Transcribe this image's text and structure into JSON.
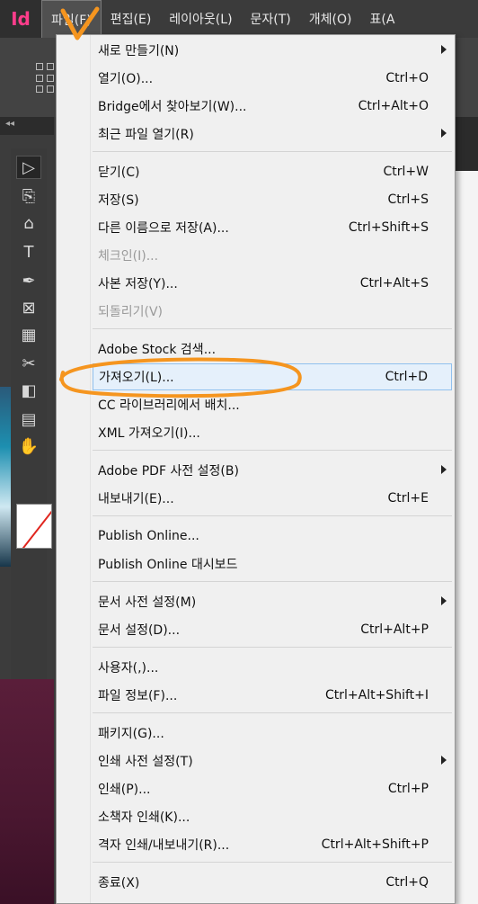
{
  "app": {
    "logo": "Id"
  },
  "menubar": {
    "items": [
      "파일(F)",
      "편집(E)",
      "레이아웃(L)",
      "문자(T)",
      "개체(O)",
      "표(A"
    ]
  },
  "panel_strip": {
    "label": "◂◂"
  },
  "file_menu": {
    "items": [
      {
        "label": "새로 만들기(N)",
        "shortcut": "",
        "submenu": true,
        "disabled": false
      },
      {
        "label": "열기(O)...",
        "shortcut": "Ctrl+O",
        "submenu": false,
        "disabled": false
      },
      {
        "label": "Bridge에서 찾아보기(W)...",
        "shortcut": "Ctrl+Alt+O",
        "submenu": false,
        "disabled": false
      },
      {
        "label": "최근 파일 열기(R)",
        "shortcut": "",
        "submenu": true,
        "disabled": false
      },
      {
        "label": "닫기(C)",
        "shortcut": "Ctrl+W",
        "submenu": false,
        "disabled": false
      },
      {
        "label": "저장(S)",
        "shortcut": "Ctrl+S",
        "submenu": false,
        "disabled": false
      },
      {
        "label": "다른 이름으로 저장(A)...",
        "shortcut": "Ctrl+Shift+S",
        "submenu": false,
        "disabled": false
      },
      {
        "label": "체크인(I)...",
        "shortcut": "",
        "submenu": false,
        "disabled": true
      },
      {
        "label": "사본 저장(Y)...",
        "shortcut": "Ctrl+Alt+S",
        "submenu": false,
        "disabled": false
      },
      {
        "label": "되돌리기(V)",
        "shortcut": "",
        "submenu": false,
        "disabled": true
      },
      {
        "label": "Adobe Stock 검색...",
        "shortcut": "",
        "submenu": false,
        "disabled": false
      },
      {
        "label": "가져오기(L)...",
        "shortcut": "Ctrl+D",
        "submenu": false,
        "disabled": false,
        "highlighted": true
      },
      {
        "label": "CC 라이브러리에서 배치...",
        "shortcut": "",
        "submenu": false,
        "disabled": false
      },
      {
        "label": "XML 가져오기(I)...",
        "shortcut": "",
        "submenu": false,
        "disabled": false
      },
      {
        "label": "Adobe PDF 사전 설정(B)",
        "shortcut": "",
        "submenu": true,
        "disabled": false
      },
      {
        "label": "내보내기(E)...",
        "shortcut": "Ctrl+E",
        "submenu": false,
        "disabled": false
      },
      {
        "label": "Publish Online...",
        "shortcut": "",
        "submenu": false,
        "disabled": false
      },
      {
        "label": "Publish Online 대시보드",
        "shortcut": "",
        "submenu": false,
        "disabled": false
      },
      {
        "label": "문서 사전 설정(M)",
        "shortcut": "",
        "submenu": true,
        "disabled": false
      },
      {
        "label": "문서 설정(D)...",
        "shortcut": "Ctrl+Alt+P",
        "submenu": false,
        "disabled": false
      },
      {
        "label": "사용자(,)...",
        "shortcut": "",
        "submenu": false,
        "disabled": false
      },
      {
        "label": "파일 정보(F)...",
        "shortcut": "Ctrl+Alt+Shift+I",
        "submenu": false,
        "disabled": false
      },
      {
        "label": "패키지(G)...",
        "shortcut": "",
        "submenu": false,
        "disabled": false
      },
      {
        "label": "인쇄 사전 설정(T)",
        "shortcut": "",
        "submenu": true,
        "disabled": false
      },
      {
        "label": "인쇄(P)...",
        "shortcut": "Ctrl+P",
        "submenu": false,
        "disabled": false
      },
      {
        "label": "소책자 인쇄(K)...",
        "shortcut": "",
        "submenu": false,
        "disabled": false
      },
      {
        "label": "격자 인쇄/내보내기(R)...",
        "shortcut": "Ctrl+Alt+Shift+P",
        "submenu": false,
        "disabled": false
      },
      {
        "label": "종료(X)",
        "shortcut": "Ctrl+Q",
        "submenu": false,
        "disabled": false
      }
    ]
  },
  "tools": [
    {
      "icon": "selection-tool-icon",
      "glyph": "▷",
      "selected": true
    },
    {
      "icon": "direct-selection-tool-icon",
      "glyph": "⎘",
      "selected": false
    },
    {
      "icon": "page-tool-icon",
      "glyph": "⌂",
      "selected": false
    },
    {
      "icon": "type-tool-icon",
      "glyph": "T",
      "selected": false
    },
    {
      "icon": "pen-tool-icon",
      "glyph": "✒",
      "selected": false
    },
    {
      "icon": "rectangle-frame-tool-icon",
      "glyph": "⊠",
      "selected": false
    },
    {
      "icon": "table-tool-icon",
      "glyph": "▦",
      "selected": false
    },
    {
      "icon": "scissors-tool-icon",
      "glyph": "✂",
      "selected": false
    },
    {
      "icon": "gradient-tool-icon",
      "glyph": "◧",
      "selected": false
    },
    {
      "icon": "note-tool-icon",
      "glyph": "▤",
      "selected": false
    },
    {
      "icon": "hand-tool-icon",
      "glyph": "✋",
      "selected": false
    }
  ],
  "colors": {
    "annotation": "#f5951f",
    "highlight_bg": "#e5f0fb",
    "logo": "#ff3d8b"
  }
}
